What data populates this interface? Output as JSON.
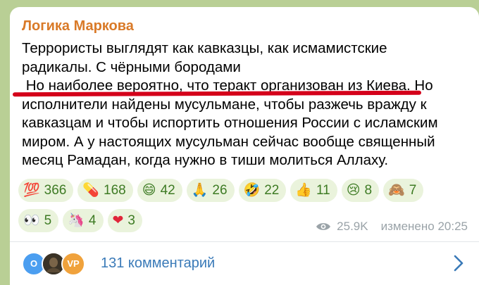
{
  "post": {
    "channel_name": "Логика Маркова",
    "text_lines": [
      "Террористы выглядят как кавказцы, как исмамистские",
      "радикалы. С чёрными бородами",
      " Но наиболее вероятно, что теракт организован из Киева. Но",
      "исполнители найдены мусульмане, чтобы разжечь вражду к",
      "кавказцам и чтобы испортить отношения России с исламским",
      "миром. А у настоящих мусульман сейчас вообще священный",
      "месяц Рамадан, когда нужно в тиши молиться Аллаху."
    ],
    "reactions": [
      {
        "emoji": "💯",
        "icon": "hundred-points-icon",
        "count": "366"
      },
      {
        "emoji": "💊",
        "icon": "pill-icon",
        "count": "168"
      },
      {
        "emoji": "😄",
        "icon": "grinning-face-icon",
        "count": "42"
      },
      {
        "emoji": "🙏",
        "icon": "folded-hands-icon",
        "count": "26"
      },
      {
        "emoji": "🤣",
        "icon": "rofl-face-icon",
        "count": "22"
      },
      {
        "emoji": "👍",
        "icon": "thumbs-up-icon",
        "count": "11"
      },
      {
        "emoji": "😢",
        "icon": "crying-face-icon",
        "count": "8"
      },
      {
        "emoji": "🙈",
        "icon": "see-no-evil-monkey-icon",
        "count": "7"
      },
      {
        "emoji": "👀",
        "icon": "eyes-icon",
        "count": "5"
      },
      {
        "emoji": "🦄",
        "icon": "unicorn-icon",
        "count": "4"
      },
      {
        "emoji": "❤",
        "icon": "red-heart-icon",
        "count": "3"
      }
    ],
    "views": "25.9K",
    "edited_label": "изменено 20:25"
  },
  "comments": {
    "label": "131 комментарий",
    "avatars": [
      {
        "initials": "O",
        "color": "#4b9ef0"
      },
      {
        "initials": "",
        "color": "#3a3226"
      },
      {
        "initials": "VP",
        "color": "#f0a23c"
      }
    ]
  },
  "colors": {
    "channel_name": "#d97a28",
    "reaction_bg": "#eaf3dc",
    "reaction_text": "#3e7b24",
    "link": "#3a7ab8",
    "underline": "#d4001a",
    "background": "#b9cf95"
  }
}
